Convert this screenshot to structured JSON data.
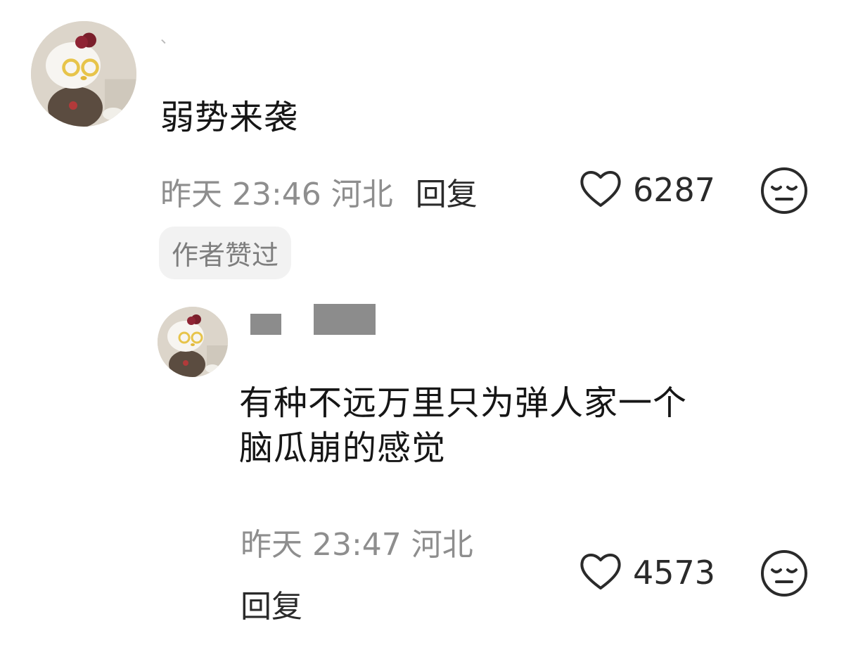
{
  "comments": [
    {
      "username": "、",
      "text": "弱势来袭",
      "time": "昨天 23:46",
      "location": "河北",
      "reply_label": "回复",
      "likes": "6287",
      "badge": "作者赞过"
    },
    {
      "text_line1": "有种不远万里只为弹人家一个",
      "text_line2": "脑瓜崩的感觉",
      "time": "昨天 23:47",
      "location": "河北",
      "reply_label": "回复",
      "likes": "4573"
    }
  ]
}
